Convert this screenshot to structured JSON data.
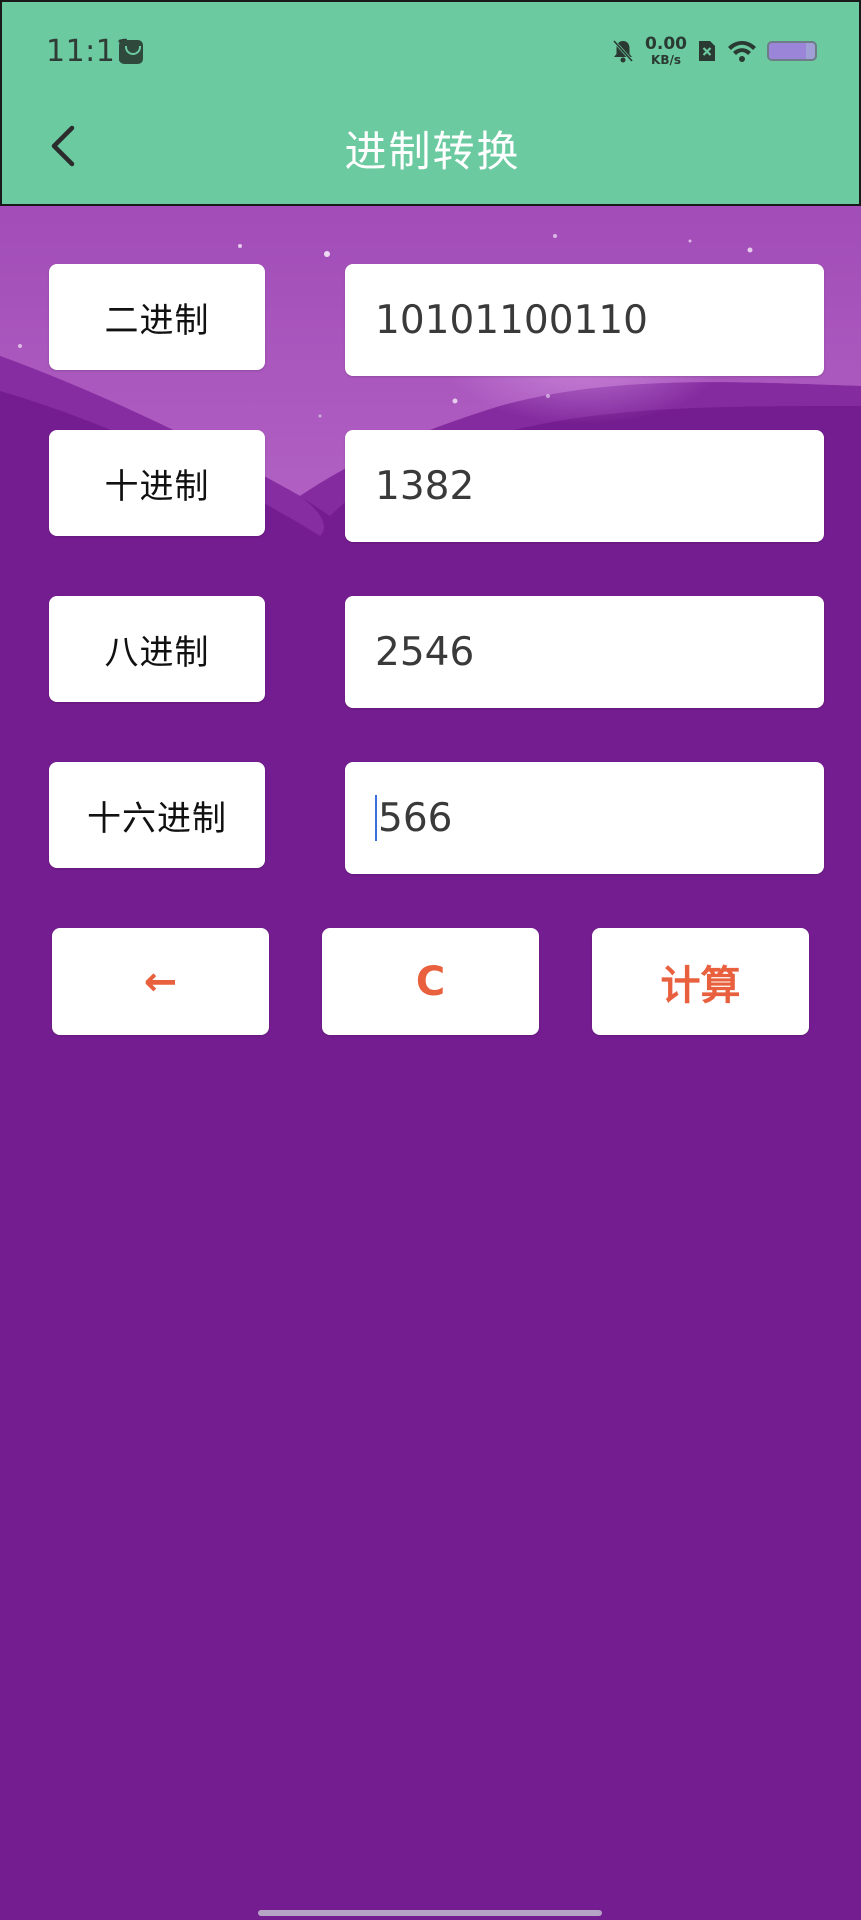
{
  "status_bar": {
    "time": "11:11",
    "net_speed_value": "0.00",
    "net_speed_unit": "KB/s",
    "battery_level": 0.8
  },
  "header": {
    "title": "进制转换",
    "bg_color": "#6BCAA0"
  },
  "rows": [
    {
      "label": "二进制",
      "value": "10101100110"
    },
    {
      "label": "十进制",
      "value": "1382"
    },
    {
      "label": "八进制",
      "value": "2546"
    },
    {
      "label": "十六进制",
      "value": "566"
    }
  ],
  "actions": {
    "backspace": "←",
    "clear": "C",
    "calculate": "计算"
  },
  "colors": {
    "background": "#741D90",
    "accent": "#E8603E",
    "caret": "#3B6FD9"
  }
}
